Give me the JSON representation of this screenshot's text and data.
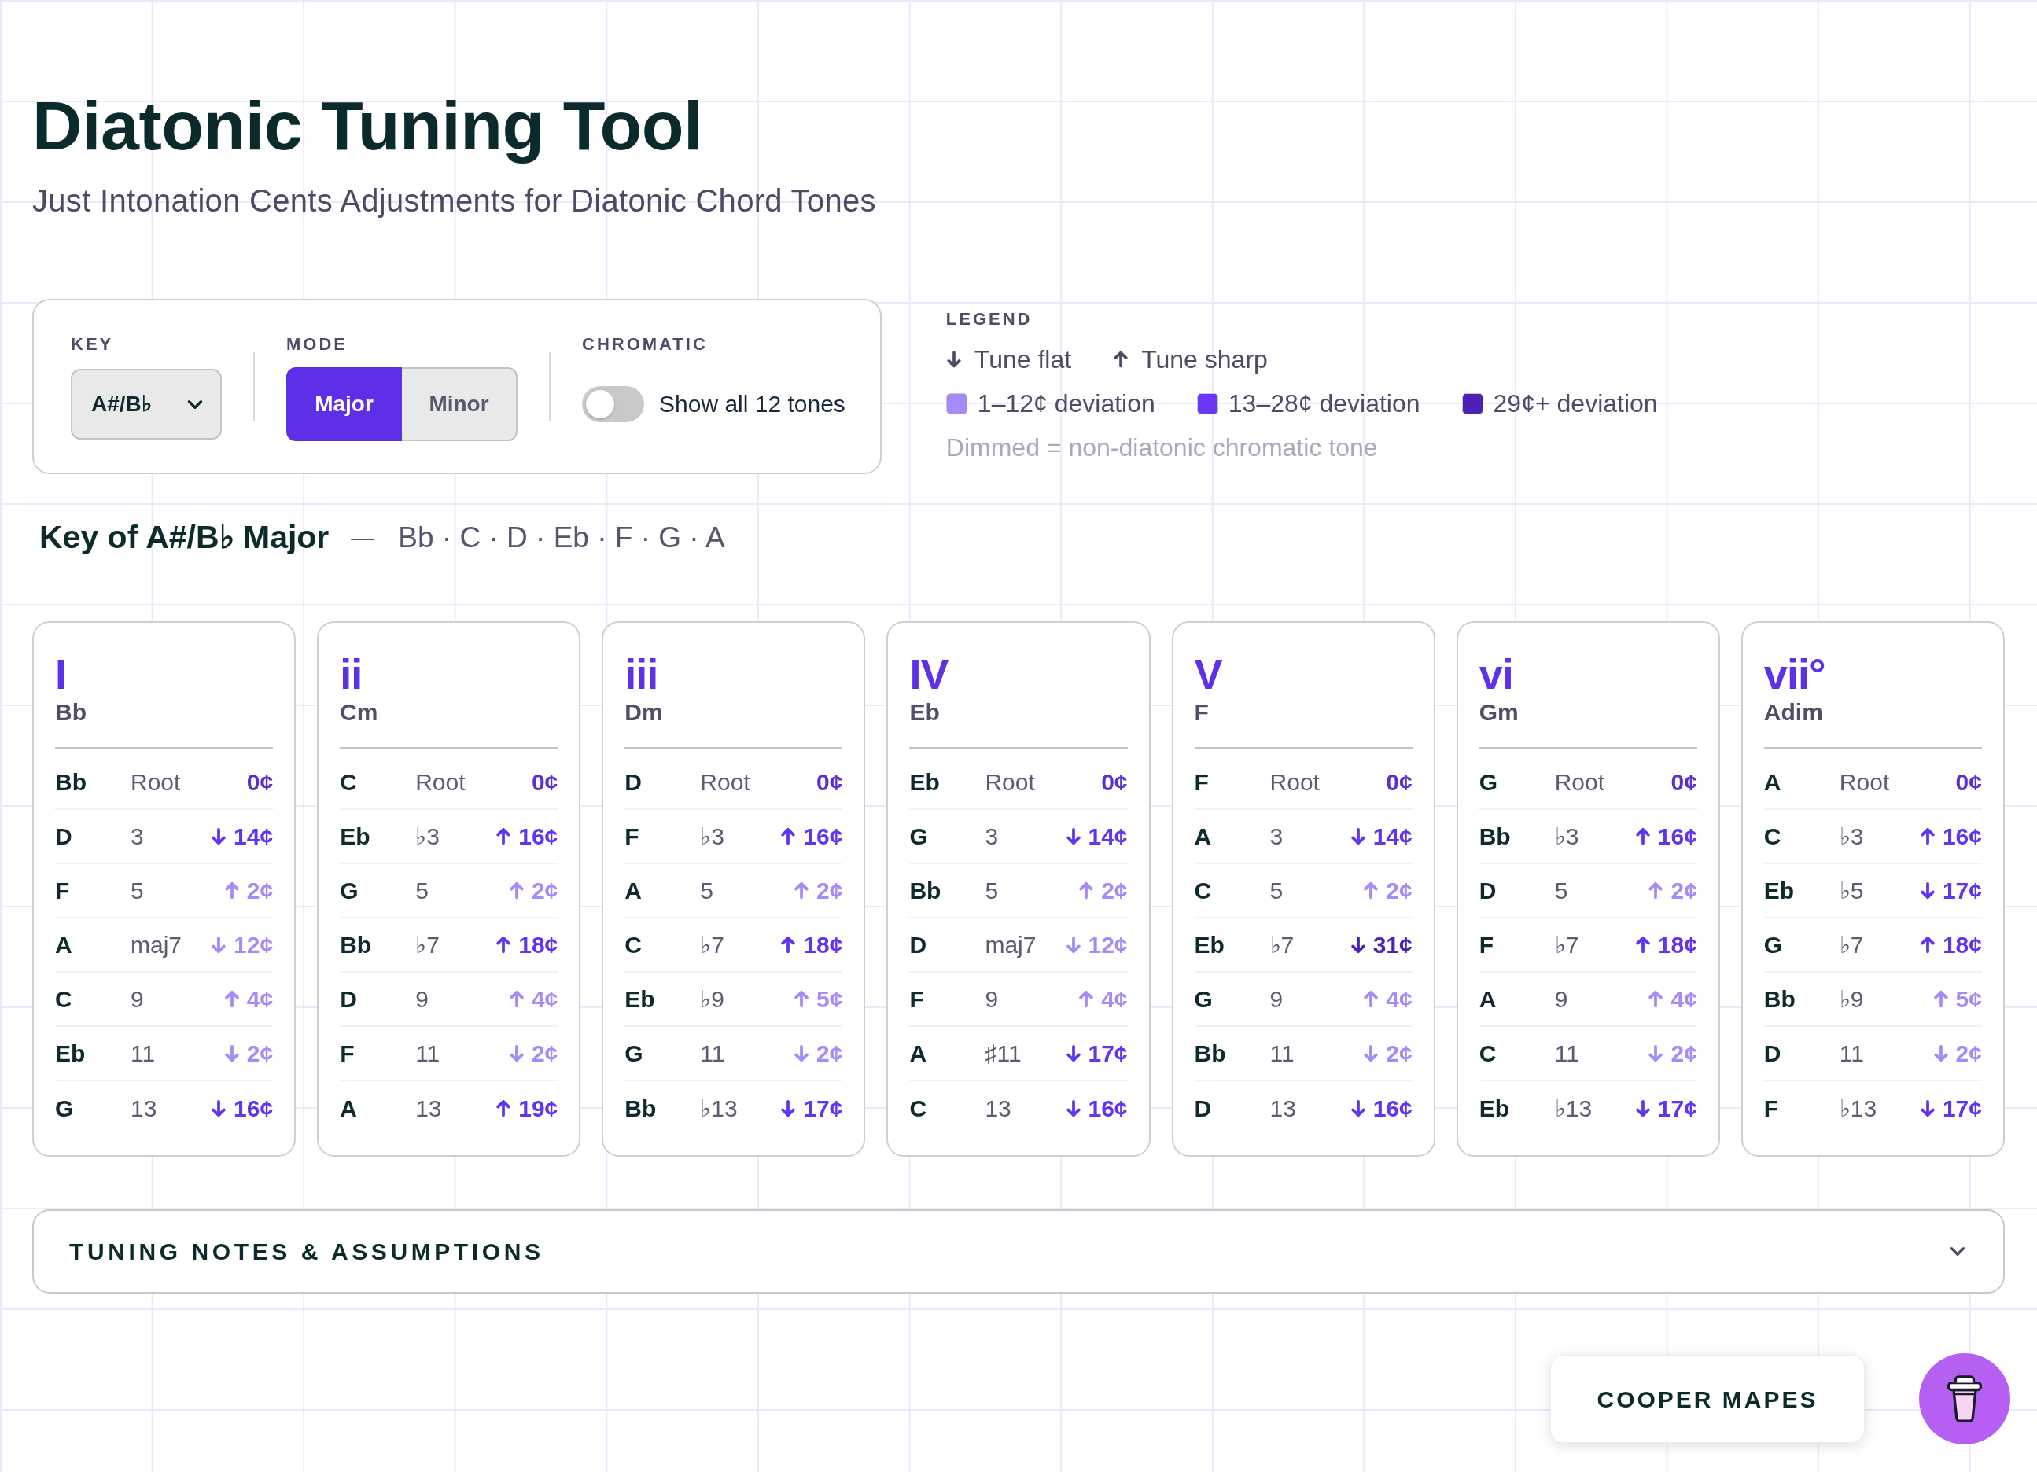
{
  "header": {
    "title": "Diatonic Tuning Tool",
    "subtitle": "Just Intonation Cents Adjustments for Diatonic Chord Tones"
  },
  "controls": {
    "key": {
      "label": "KEY",
      "value": "A#/B♭"
    },
    "mode": {
      "label": "MODE",
      "options": [
        {
          "label": "Major",
          "selected": true
        },
        {
          "label": "Minor",
          "selected": false
        }
      ]
    },
    "chromatic": {
      "label": "CHROMATIC",
      "on": false,
      "text": "Show all 12 tones"
    }
  },
  "legend": {
    "title": "LEGEND",
    "directions": [
      {
        "kind": "flat",
        "label": "Tune flat"
      },
      {
        "kind": "sharp",
        "label": "Tune sharp"
      }
    ],
    "swatches": [
      {
        "color": "#a58af8",
        "label": "1–12¢ deviation"
      },
      {
        "color": "#6a38f6",
        "label": "13–28¢ deviation"
      },
      {
        "color": "#4b22b5",
        "label": "29¢+ deviation"
      }
    ],
    "note": "Dimmed = non-diatonic chromatic tone"
  },
  "key_heading": {
    "title": "Key of A#/B♭ Major",
    "separator": "—",
    "notes": "Bb · C · D · Eb · F · G · A"
  },
  "chords": [
    {
      "numeral": "I",
      "name": "Bb",
      "tones": [
        {
          "kind": "root",
          "note": "Bb",
          "interval": "Root",
          "cents": "0¢",
          "color": "#5b30d0"
        },
        {
          "kind": "flat",
          "note": "D",
          "interval": "3",
          "cents": "14¢",
          "color": "#6234f0"
        },
        {
          "kind": "sharp",
          "note": "F",
          "interval": "5",
          "cents": "2¢",
          "color": "#a58af8"
        },
        {
          "kind": "flat",
          "note": "A",
          "interval": "maj7",
          "cents": "12¢",
          "color": "#a58af8"
        },
        {
          "kind": "sharp",
          "note": "C",
          "interval": "9",
          "cents": "4¢",
          "color": "#a58af8"
        },
        {
          "kind": "flat",
          "note": "Eb",
          "interval": "11",
          "cents": "2¢",
          "color": "#a58af8"
        },
        {
          "kind": "flat",
          "note": "G",
          "interval": "13",
          "cents": "16¢",
          "color": "#6234f0"
        }
      ]
    },
    {
      "numeral": "ii",
      "name": "Cm",
      "tones": [
        {
          "kind": "root",
          "note": "C",
          "interval": "Root",
          "cents": "0¢",
          "color": "#5b30d0"
        },
        {
          "kind": "sharp",
          "note": "Eb",
          "interval": "♭3",
          "cents": "16¢",
          "color": "#6234f0"
        },
        {
          "kind": "sharp",
          "note": "G",
          "interval": "5",
          "cents": "2¢",
          "color": "#a58af8"
        },
        {
          "kind": "sharp",
          "note": "Bb",
          "interval": "♭7",
          "cents": "18¢",
          "color": "#6234f0"
        },
        {
          "kind": "sharp",
          "note": "D",
          "interval": "9",
          "cents": "4¢",
          "color": "#a58af8"
        },
        {
          "kind": "flat",
          "note": "F",
          "interval": "11",
          "cents": "2¢",
          "color": "#a58af8"
        },
        {
          "kind": "sharp",
          "note": "A",
          "interval": "13",
          "cents": "19¢",
          "color": "#6234f0"
        }
      ]
    },
    {
      "numeral": "iii",
      "name": "Dm",
      "tones": [
        {
          "kind": "root",
          "note": "D",
          "interval": "Root",
          "cents": "0¢",
          "color": "#5b30d0"
        },
        {
          "kind": "sharp",
          "note": "F",
          "interval": "♭3",
          "cents": "16¢",
          "color": "#6234f0"
        },
        {
          "kind": "sharp",
          "note": "A",
          "interval": "5",
          "cents": "2¢",
          "color": "#a58af8"
        },
        {
          "kind": "sharp",
          "note": "C",
          "interval": "♭7",
          "cents": "18¢",
          "color": "#6234f0"
        },
        {
          "kind": "sharp",
          "note": "Eb",
          "interval": "♭9",
          "cents": "5¢",
          "color": "#a58af8"
        },
        {
          "kind": "flat",
          "note": "G",
          "interval": "11",
          "cents": "2¢",
          "color": "#a58af8"
        },
        {
          "kind": "flat",
          "note": "Bb",
          "interval": "♭13",
          "cents": "17¢",
          "color": "#6234f0"
        }
      ]
    },
    {
      "numeral": "IV",
      "name": "Eb",
      "tones": [
        {
          "kind": "root",
          "note": "Eb",
          "interval": "Root",
          "cents": "0¢",
          "color": "#5b30d0"
        },
        {
          "kind": "flat",
          "note": "G",
          "interval": "3",
          "cents": "14¢",
          "color": "#6234f0"
        },
        {
          "kind": "sharp",
          "note": "Bb",
          "interval": "5",
          "cents": "2¢",
          "color": "#a58af8"
        },
        {
          "kind": "flat",
          "note": "D",
          "interval": "maj7",
          "cents": "12¢",
          "color": "#a58af8"
        },
        {
          "kind": "sharp",
          "note": "F",
          "interval": "9",
          "cents": "4¢",
          "color": "#a58af8"
        },
        {
          "kind": "flat",
          "note": "A",
          "interval": "♯11",
          "cents": "17¢",
          "color": "#6234f0"
        },
        {
          "kind": "flat",
          "note": "C",
          "interval": "13",
          "cents": "16¢",
          "color": "#6234f0"
        }
      ]
    },
    {
      "numeral": "V",
      "name": "F",
      "tones": [
        {
          "kind": "root",
          "note": "F",
          "interval": "Root",
          "cents": "0¢",
          "color": "#5b30d0"
        },
        {
          "kind": "flat",
          "note": "A",
          "interval": "3",
          "cents": "14¢",
          "color": "#6234f0"
        },
        {
          "kind": "sharp",
          "note": "C",
          "interval": "5",
          "cents": "2¢",
          "color": "#a58af8"
        },
        {
          "kind": "flat",
          "note": "Eb",
          "interval": "♭7",
          "cents": "31¢",
          "color": "#4b22b5"
        },
        {
          "kind": "sharp",
          "note": "G",
          "interval": "9",
          "cents": "4¢",
          "color": "#a58af8"
        },
        {
          "kind": "flat",
          "note": "Bb",
          "interval": "11",
          "cents": "2¢",
          "color": "#a58af8"
        },
        {
          "kind": "flat",
          "note": "D",
          "interval": "13",
          "cents": "16¢",
          "color": "#6234f0"
        }
      ]
    },
    {
      "numeral": "vi",
      "name": "Gm",
      "tones": [
        {
          "kind": "root",
          "note": "G",
          "interval": "Root",
          "cents": "0¢",
          "color": "#5b30d0"
        },
        {
          "kind": "sharp",
          "note": "Bb",
          "interval": "♭3",
          "cents": "16¢",
          "color": "#6234f0"
        },
        {
          "kind": "sharp",
          "note": "D",
          "interval": "5",
          "cents": "2¢",
          "color": "#a58af8"
        },
        {
          "kind": "sharp",
          "note": "F",
          "interval": "♭7",
          "cents": "18¢",
          "color": "#6234f0"
        },
        {
          "kind": "sharp",
          "note": "A",
          "interval": "9",
          "cents": "4¢",
          "color": "#a58af8"
        },
        {
          "kind": "flat",
          "note": "C",
          "interval": "11",
          "cents": "2¢",
          "color": "#a58af8"
        },
        {
          "kind": "flat",
          "note": "Eb",
          "interval": "♭13",
          "cents": "17¢",
          "color": "#6234f0"
        }
      ]
    },
    {
      "numeral": "vii°",
      "name": "Adim",
      "tones": [
        {
          "kind": "root",
          "note": "A",
          "interval": "Root",
          "cents": "0¢",
          "color": "#5b30d0"
        },
        {
          "kind": "sharp",
          "note": "C",
          "interval": "♭3",
          "cents": "16¢",
          "color": "#6234f0"
        },
        {
          "kind": "flat",
          "note": "Eb",
          "interval": "♭5",
          "cents": "17¢",
          "color": "#6234f0"
        },
        {
          "kind": "sharp",
          "note": "G",
          "interval": "♭7",
          "cents": "18¢",
          "color": "#6234f0"
        },
        {
          "kind": "sharp",
          "note": "Bb",
          "interval": "♭9",
          "cents": "5¢",
          "color": "#a58af8"
        },
        {
          "kind": "flat",
          "note": "D",
          "interval": "11",
          "cents": "2¢",
          "color": "#a58af8"
        },
        {
          "kind": "flat",
          "note": "F",
          "interval": "♭13",
          "cents": "17¢",
          "color": "#6234f0"
        }
      ]
    }
  ],
  "notes_panel": {
    "title": "TUNING NOTES & ASSUMPTIONS",
    "expanded": false
  },
  "credit": {
    "label": "COOPER MAPES"
  }
}
